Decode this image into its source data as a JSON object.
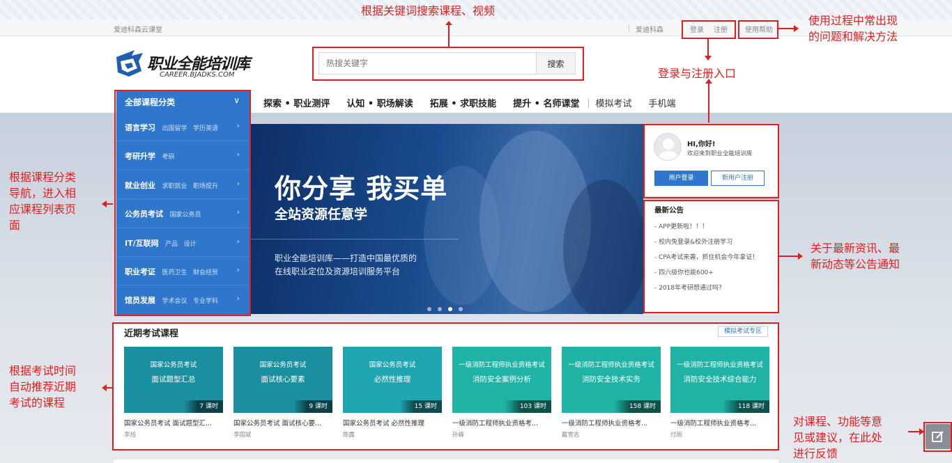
{
  "topbar": {
    "site": "爱迪科森云课堂",
    "site2": "爱迪科森",
    "login": "登录",
    "register": "注册",
    "help": "使用帮助"
  },
  "logo": {
    "name": "职业全能培训库",
    "domain": "CAREER.BJADKS.COM"
  },
  "search": {
    "placeholder": "热搜关键字",
    "button": "搜索"
  },
  "nav": {
    "category_head": "全部课程分类",
    "items": [
      "探索 • 职业测评",
      "认知 • 职场解读",
      "拓展 • 求职技能",
      "提升 • 名师课堂",
      "模拟考试",
      "手机端"
    ]
  },
  "categories": [
    {
      "main": "语言学习",
      "subs": [
        "出国留学",
        "学历英语"
      ]
    },
    {
      "main": "考研升学",
      "subs": [
        "考研"
      ]
    },
    {
      "main": "就业创业",
      "subs": [
        "求职就业",
        "职场提升"
      ]
    },
    {
      "main": "公务员考试",
      "subs": [
        "国家公务员"
      ]
    },
    {
      "main": "IT/互联网",
      "subs": [
        "产品",
        "设计"
      ]
    },
    {
      "main": "职业考证",
      "subs": [
        "医药卫生",
        "财会经贸"
      ]
    },
    {
      "main": "馆员发展",
      "subs": [
        "学术会议",
        "专业学科"
      ]
    }
  ],
  "banner": {
    "headline": "你分享 我买单",
    "subline": "全站资源任意学",
    "desc1": "职业全能培训库——打造中国最优质的",
    "desc2": "在线职业定位及资源培训服务平台",
    "active_slide": 3,
    "slide_count": 4
  },
  "user": {
    "hi": "HI,你好!",
    "welcome": "欢迎来到职业全能培训库",
    "login_btn": "用户登录",
    "register_btn": "新用户注册"
  },
  "notices": {
    "title": "最新公告",
    "items": [
      "- APP更新啦！！！",
      "- 校内免登录&校外注册学习",
      "- CPA考试来袭，抓住机会今年拿证！",
      "- 四六级你也能600+",
      "- 2018年考研想通过吗？"
    ]
  },
  "exams": {
    "title": "近期考试课程",
    "more": "模拟考试专区",
    "courses": [
      {
        "l1": "国家公务员考试",
        "l2": "面试题型汇总",
        "hours": "7 课时",
        "name": "国家公务员考试 面试题型汇...",
        "teacher": "李旭"
      },
      {
        "l1": "国家公务员考试",
        "l2": "面试核心要素",
        "hours": "9 课时",
        "name": "国家公务员考试 面试核心要...",
        "teacher": "李国斌"
      },
      {
        "l1": "国家公务员考试",
        "l2": "必然性推理",
        "hours": "15 课时",
        "name": "国家公务员考试 必然性推理",
        "teacher": "陈露"
      },
      {
        "l1": "一级消防工程师执业资格考试",
        "l2": "消防安全案例分析",
        "hours": "103 课时",
        "name": "一级消防工程师执业资格考...",
        "teacher": "孙峰"
      },
      {
        "l1": "一级消防工程师执业资格考试",
        "l2": "消防安全技术实务",
        "hours": "158 课时",
        "name": "一级消防工程师执业资格考...",
        "teacher": "戴雪志"
      },
      {
        "l1": "一级消防工程师执业资格考试",
        "l2": "消防安全技术综合能力",
        "hours": "118 课时",
        "name": "一级消防工程师执业资格考...",
        "teacher": "付雨"
      }
    ]
  },
  "annotations": {
    "search": "根据关键词搜索课程、视频",
    "help_l1": "使用过程中常出现",
    "help_l2": "的问题和解决方法",
    "login": "登录与注册入口",
    "cat_l1": "根据课程分类",
    "cat_l2": "导航，进入相",
    "cat_l3": "应课程列表页",
    "cat_l4": "面",
    "notice_l1": "关于最新资讯、最",
    "notice_l2": "新动态等公告通知",
    "exam_l1": "根据考试时间",
    "exam_l2": "自动推荐近期",
    "exam_l3": "考试的课程",
    "fb_l1": "对课程、功能等意",
    "fb_l2": "见或建议，在此处",
    "fb_l3": "进行反馈"
  },
  "colors": {
    "brand": "#2f77cc",
    "annotation": "#e21d1d"
  },
  "icons": {
    "feedback": "edit-icon",
    "category_toggle": "chevron-down-icon"
  }
}
